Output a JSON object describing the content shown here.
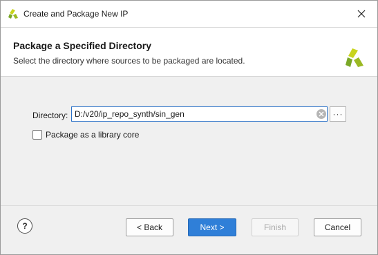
{
  "window": {
    "title": "Create and Package New IP",
    "close_icon": "close-icon",
    "app_icon": "vivado-logo-icon"
  },
  "header": {
    "title": "Package a Specified Directory",
    "subtitle": "Select the directory where sources to be packaged are located.",
    "logo_icon": "vivado-logo-icon"
  },
  "form": {
    "directory_label": "Directory:",
    "directory_value": "D:/v20/ip_repo_synth/sin_gen",
    "browse_label": "···",
    "library_core_label": "Package as a library core",
    "library_core_checked": false
  },
  "footer": {
    "help_label": "?",
    "back_label": "< Back",
    "next_label": "Next >",
    "finish_label": "Finish",
    "cancel_label": "Cancel"
  },
  "colors": {
    "accent": "#2f7fd8",
    "logo_green": "#7aa827",
    "logo_yellow": "#c8d41d"
  }
}
